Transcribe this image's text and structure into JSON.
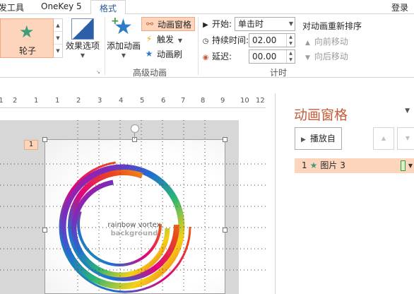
{
  "tabs": {
    "picture_tools": "发工具",
    "onekey": "OneKey 5",
    "format": "格式",
    "login": "登录"
  },
  "ribbon": {
    "animation_gallery": {
      "selected": "轮子",
      "icon": "star-icon"
    },
    "effect_options": "效果选项",
    "add_animation": "添加动画",
    "animation_pane_button": "动画窗格",
    "trigger": "触发",
    "animation_painter": "动画刷",
    "advanced_group": "高级动画",
    "timing": {
      "start_label": "开始:",
      "start_value": "单击时",
      "duration_label": "持续时间:",
      "duration_value": "02.00",
      "delay_label": "延迟:",
      "delay_value": "00.00",
      "group": "计时"
    },
    "reorder": {
      "title": "对动画重新排序",
      "move_earlier": "向前移动",
      "move_later": "向后移动"
    }
  },
  "ruler": {
    "ticks": [
      "2",
      "1",
      "1",
      "2",
      "3",
      "4",
      "5",
      "6",
      "7",
      "8",
      "9",
      "10",
      "11",
      "12"
    ]
  },
  "slide": {
    "animation_tag": "1",
    "image_text_line1": "rainbow vortex",
    "image_text_line2": "background"
  },
  "animation_pane": {
    "title": "动画窗格",
    "play_button": "播放自",
    "items": [
      {
        "number": "1",
        "name": "图片 3"
      }
    ]
  },
  "colors": {
    "accent": "#c75b39",
    "highlight": "#fcd5bc",
    "highlight_border": "#f0a882",
    "star_green": "#3e9e7a"
  }
}
